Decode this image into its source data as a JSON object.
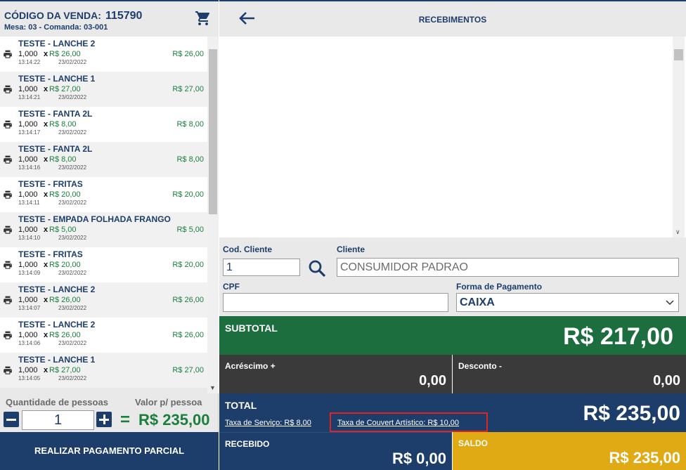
{
  "sale": {
    "code_label": "CÓDIGO DA VENDA:",
    "code_value": "115790",
    "sub": "Mesa: 03  -  Comanda: 03-001"
  },
  "icons": {
    "cart": "shopping-cart-icon",
    "print": "printer-icon",
    "back": "arrow-left-icon",
    "search": "search-icon",
    "dropdown": "chevron-down-icon"
  },
  "items": [
    {
      "name": "TESTE - LANCHE 2",
      "qty": "1,000",
      "x": "x",
      "unit": "R$ 26,00",
      "time": "13:14:22",
      "date": "23/02/2022",
      "total": "R$ 26,00"
    },
    {
      "name": "TESTE - LANCHE 1",
      "qty": "1,000",
      "x": "x",
      "unit": "R$ 27,00",
      "time": "13:14:21",
      "date": "23/02/2022",
      "total": "R$ 27,00"
    },
    {
      "name": "TESTE - FANTA 2L",
      "qty": "1,000",
      "x": "x",
      "unit": "R$ 8,00",
      "time": "13:14:17",
      "date": "23/02/2022",
      "total": "R$ 8,00"
    },
    {
      "name": "TESTE - FANTA 2L",
      "qty": "1,000",
      "x": "x",
      "unit": "R$ 8,00",
      "time": "13:14:16",
      "date": "23/02/2022",
      "total": "R$ 8,00"
    },
    {
      "name": "TESTE - FRITAS",
      "qty": "1,000",
      "x": "x",
      "unit": "R$ 20,00",
      "time": "13:14:11",
      "date": "23/02/2022",
      "total": "R$ 20,00"
    },
    {
      "name": "TESTE - EMPADA FOLHADA FRANGO",
      "qty": "1,000",
      "x": "x",
      "unit": "R$ 5,00",
      "time": "13:14:10",
      "date": "23/02/2022",
      "total": "R$ 5,00"
    },
    {
      "name": "TESTE - FRITAS",
      "qty": "1,000",
      "x": "x",
      "unit": "R$ 20,00",
      "time": "13:14:09",
      "date": "23/02/2022",
      "total": "R$ 20,00"
    },
    {
      "name": "TESTE - LANCHE 2",
      "qty": "1,000",
      "x": "x",
      "unit": "R$ 26,00",
      "time": "13:14:07",
      "date": "23/02/2022",
      "total": "R$ 26,00"
    },
    {
      "name": "TESTE - LANCHE 2",
      "qty": "1,000",
      "x": "x",
      "unit": "R$ 26,00",
      "time": "13:14:06",
      "date": "23/02/2022",
      "total": "R$ 26,00"
    },
    {
      "name": "TESTE - LANCHE 1",
      "qty": "1,000",
      "x": "x",
      "unit": "R$ 27,00",
      "time": "13:14:05",
      "date": "23/02/2022",
      "total": "R$ 27,00"
    }
  ],
  "people": {
    "label": "Quantidade de pessoas",
    "per_person_label": "Valor p/ pessoa",
    "count": "1",
    "equals": "=",
    "per_person_value": "R$ 235,00"
  },
  "partial_button": "REALIZAR PAGAMENTO PARCIAL",
  "header": {
    "title": "RECEBIMENTOS"
  },
  "form": {
    "cod_label": "Cod. Cliente",
    "cod_value": "1",
    "client_label": "Cliente",
    "client_value": "CONSUMIDOR PADRAO",
    "cpf_label": "CPF",
    "cpf_value": "",
    "payment_label": "Forma de Pagamento",
    "payment_value": "CAIXA"
  },
  "subtotal": {
    "label": "SUBTOTAL",
    "value": "R$ 217,00"
  },
  "acrescimo": {
    "label": "Acréscimo +",
    "value": "0,00"
  },
  "desconto": {
    "label": "Desconto -",
    "value": "0,00"
  },
  "total": {
    "label": "TOTAL",
    "value": "R$ 235,00",
    "service_fee": "Taxa de Serviço: R$ 8,00",
    "couvert_fee": "Taxa de Couvert Artístico: R$ 10,00"
  },
  "received": {
    "label": "RECEBIDO",
    "value": "R$ 0,00"
  },
  "saldo": {
    "label": "SALDO",
    "value": "R$ 235,00"
  },
  "colors": {
    "navy": "#1d3d6b",
    "green": "#1d6e3f",
    "price_green": "#1a7f3c",
    "dark": "#3a3a3a",
    "gold": "#e0aa14",
    "highlight_red": "#e32222"
  }
}
